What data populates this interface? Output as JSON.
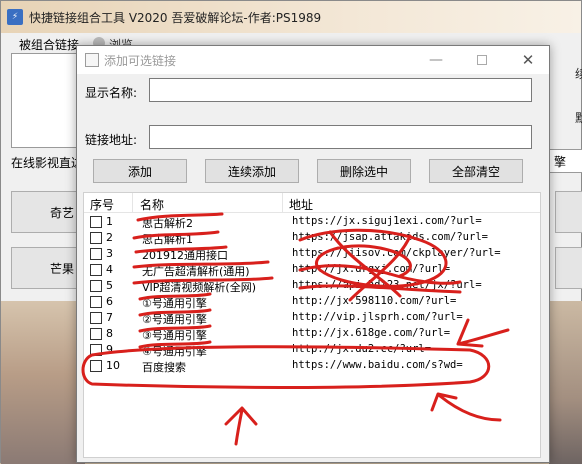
{
  "main_window": {
    "title": "快捷链接组合工具 V2020   吾爱破解论坛-作者:PS1989",
    "label_links": "被组合链接",
    "browse_label": "浏览",
    "label_online": "在线影视直达",
    "button_1_label": "奇艺",
    "button_2_label": "芒果",
    "right_input_value": "擎",
    "right_fragment_1": "续",
    "right_fragment_2": "默"
  },
  "dialog": {
    "title": "添加可选链接",
    "name_label": "显示名称:",
    "name_value": "",
    "url_label": "链接地址:",
    "url_value": "",
    "buttons": {
      "add": "添加",
      "continuous_add": "连续添加",
      "delete_selected": "删除选中",
      "clear_all": "全部清空"
    },
    "list": {
      "columns": [
        "序号",
        "名称",
        "地址"
      ],
      "rows": [
        {
          "no": "1",
          "name": "思古解析2",
          "url": "https://jx.siguj1exi.com/?url="
        },
        {
          "no": "2",
          "name": "思古解析1",
          "url": "https://jsap.attakids.com/?url="
        },
        {
          "no": "3",
          "name": "201912通用接口",
          "url": "https://jiisov.com/ckplayer/?url="
        },
        {
          "no": "4",
          "name": "无广告超清解析(通用)",
          "url": "http://jx.drgxj.com/?url="
        },
        {
          "no": "5",
          "name": "VIP超清视频解析(全网)",
          "url": "https://api.hdi23.net/jx/?url="
        },
        {
          "no": "6",
          "name": "①号通用引擎",
          "url": "http://jx.598110.com/?url="
        },
        {
          "no": "7",
          "name": "②号通用引擎",
          "url": "http://vip.jlsprh.com/?url="
        },
        {
          "no": "8",
          "name": "③号通用引擎",
          "url": "http://jx.618ge.com/?url="
        },
        {
          "no": "9",
          "name": "④号通用引擎",
          "url": "http://jx.du2.cc/?url="
        },
        {
          "no": "10",
          "name": "百度搜索",
          "url": "https://www.baidu.com/s?wd="
        }
      ]
    }
  },
  "colors": {
    "annotation_red": "#d8201c",
    "dialog_bg": "#f0f0f0",
    "button_bg": "#e1e1e1"
  },
  "icons": {
    "app": "app-icon",
    "dialog": "dialog-icon",
    "minimize": "minimize-icon",
    "maximize": "maximize-icon",
    "close": "close-icon"
  }
}
